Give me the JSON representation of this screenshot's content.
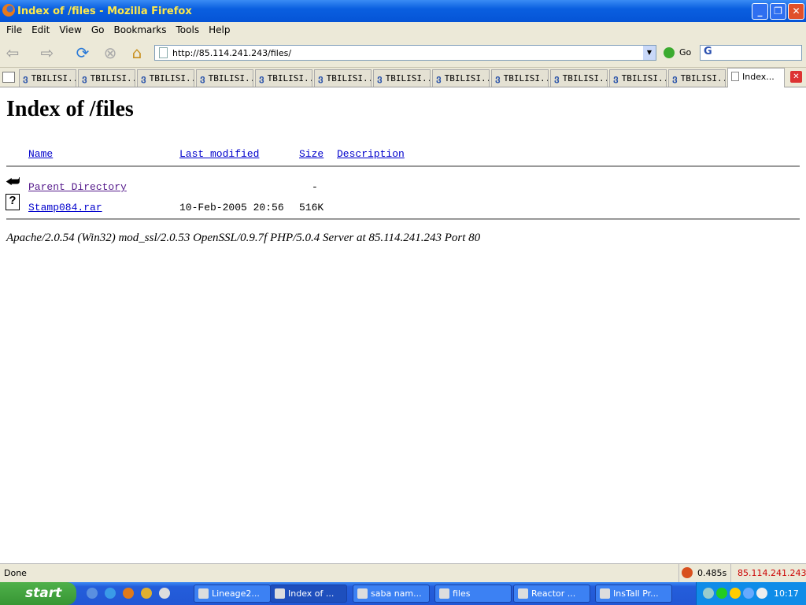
{
  "window": {
    "title": "Index of /files - Mozilla Firefox"
  },
  "menu": [
    "File",
    "Edit",
    "View",
    "Go",
    "Bookmarks",
    "Tools",
    "Help"
  ],
  "nav": {
    "url": "http://85.114.241.243/files/",
    "go_label": "Go"
  },
  "tabs": [
    "TBILISI...",
    "TBILISI...",
    "TBILISI...",
    "TBILISI...",
    "TBILISI...",
    "TBILISI...",
    "TBILISI...",
    "TBILISI...",
    "TBILISI...",
    "TBILISI...",
    "TBILISI...",
    "TBILISI...",
    "Index..."
  ],
  "page": {
    "heading": "Index of /files",
    "columns": {
      "name": "Name",
      "modified": "Last modified",
      "size": "Size",
      "description": "Description"
    },
    "rows": [
      {
        "name": "Parent Directory",
        "modified": "",
        "size": "-",
        "icon": "back-icon"
      },
      {
        "name": "Stamp084.rar",
        "modified": "10-Feb-2005 20:56",
        "size": "516K",
        "icon": "unknown-file-icon"
      }
    ],
    "footer": "Apache/2.0.54 (Win32) mod_ssl/2.0.53 OpenSSL/0.9.7f PHP/5.0.4 Server at 85.114.241.243 Port 80"
  },
  "status": {
    "text": "Done",
    "time": "0.485s",
    "ip": "85.114.241.243",
    "ip_color": "#cc0000"
  },
  "taskbar": {
    "start": "start",
    "tasks": [
      "Lineage2...",
      "Index of ...",
      "saba nam...",
      "files",
      "Reactor ...",
      "InsTall Pr..."
    ],
    "clock": "10:17"
  }
}
